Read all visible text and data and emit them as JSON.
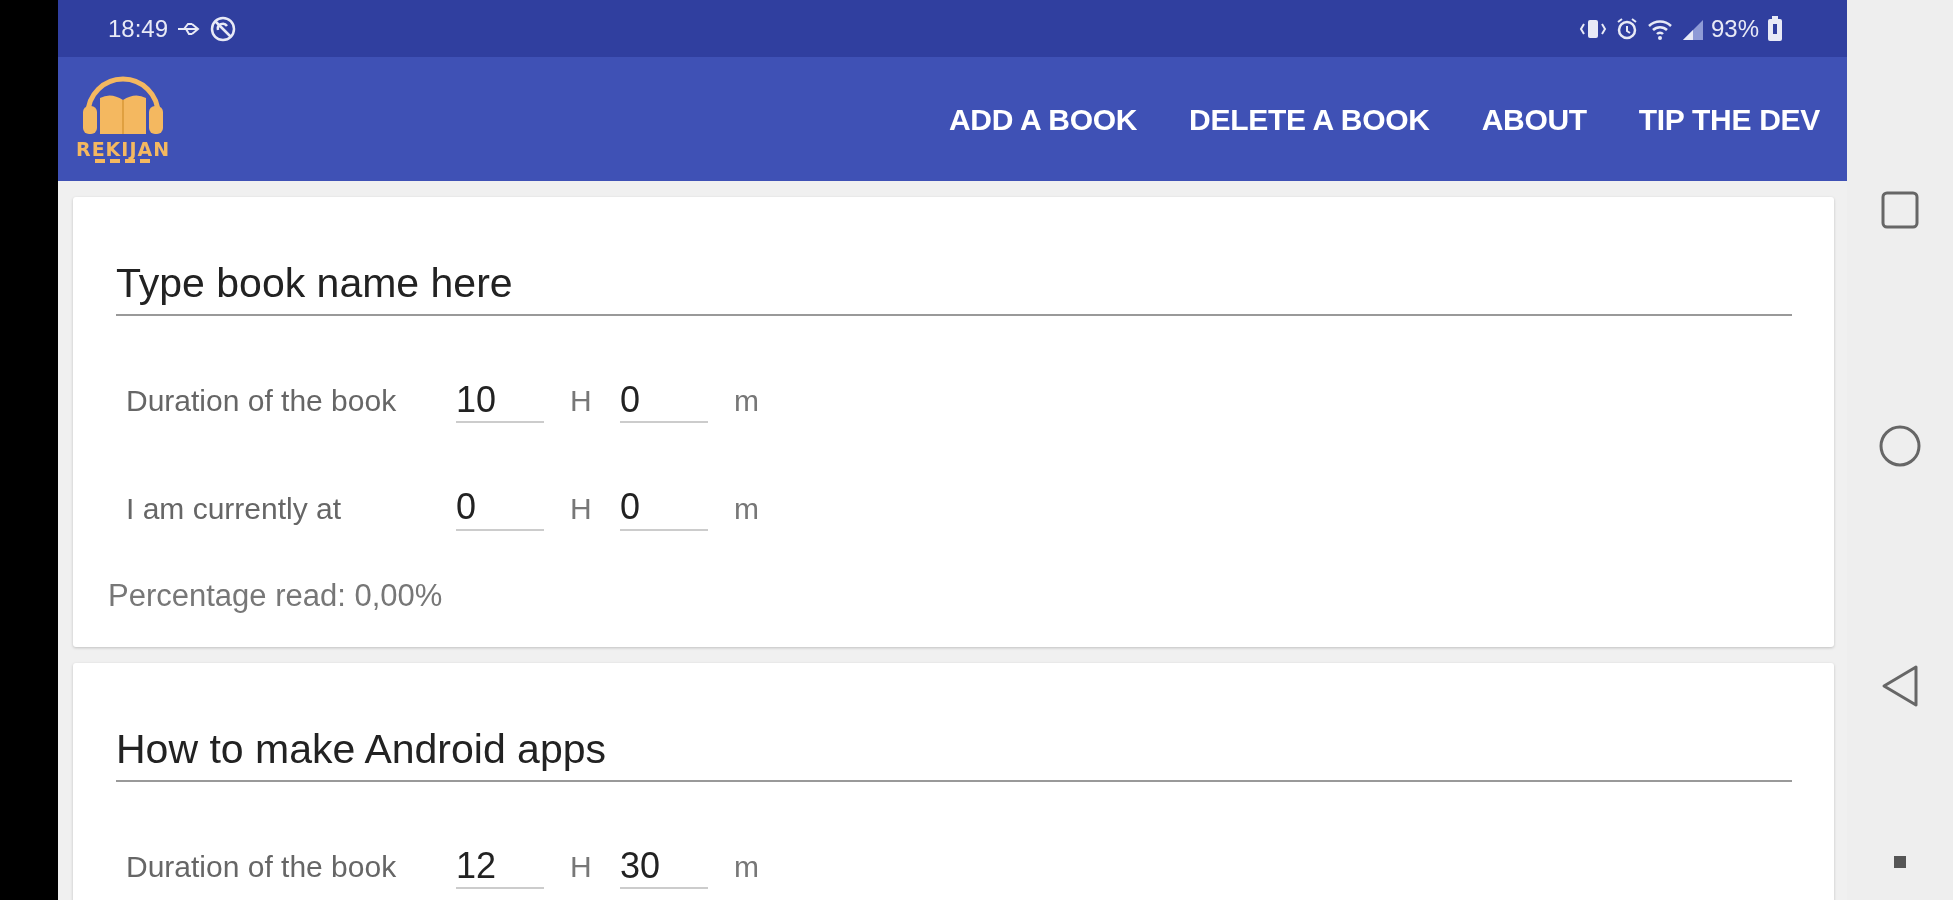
{
  "status_bar": {
    "time": "18:49",
    "battery": "93%"
  },
  "app_bar": {
    "logo_text": "REKIJAN",
    "menu": [
      "ADD A BOOK",
      "DELETE A BOOK",
      "ABOUT",
      "TIP THE DEV"
    ]
  },
  "books": [
    {
      "name": "Type book name here",
      "rows": [
        {
          "label": "Duration of the book",
          "hours": "10",
          "hours_unit": "H",
          "minutes": "0",
          "minutes_unit": "m"
        },
        {
          "label": "I am currently at",
          "hours": "0",
          "hours_unit": "H",
          "minutes": "0",
          "minutes_unit": "m"
        }
      ],
      "percentage": "Percentage read: 0,00%"
    },
    {
      "name": "How to make Android apps",
      "rows": [
        {
          "label": "Duration of the book",
          "hours": "12",
          "hours_unit": "H",
          "minutes": "30",
          "minutes_unit": "m"
        }
      ]
    }
  ]
}
